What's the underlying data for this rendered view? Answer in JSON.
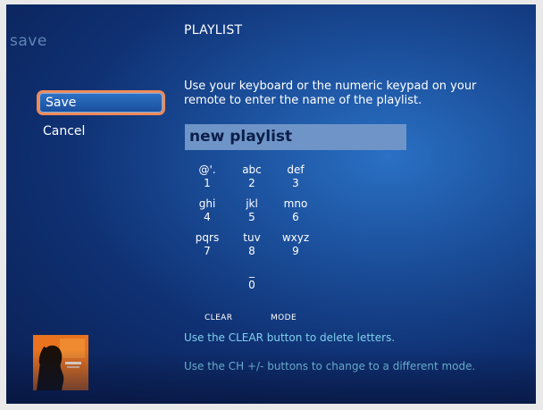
{
  "page_label": "save",
  "menu": {
    "items": [
      {
        "label": "Save",
        "selected": true
      },
      {
        "label": "Cancel",
        "selected": false
      }
    ]
  },
  "title": "PLAYLIST",
  "instructions": "Use your keyboard or the numeric keypad on your remote to enter the name of the playlist.",
  "name_field": {
    "value": "new playlist"
  },
  "keypad": {
    "k1": {
      "letters": "@'.",
      "digit": "1"
    },
    "k2": {
      "letters": "abc",
      "digit": "2"
    },
    "k3": {
      "letters": "def",
      "digit": "3"
    },
    "k4": {
      "letters": "ghi",
      "digit": "4"
    },
    "k5": {
      "letters": "jkl",
      "digit": "5"
    },
    "k6": {
      "letters": "mno",
      "digit": "6"
    },
    "k7": {
      "letters": "pqrs",
      "digit": "7"
    },
    "k8": {
      "letters": "tuv",
      "digit": "8"
    },
    "k9": {
      "letters": "wxyz",
      "digit": "9"
    },
    "k0": {
      "letters": "_",
      "digit": "0"
    }
  },
  "soft_keys": {
    "clear": "CLEAR",
    "mode": "MODE"
  },
  "hints": {
    "clear": "Use the CLEAR button to delete letters.",
    "mode": "Use the CH +/- buttons to change to a different mode."
  },
  "album_art": {
    "icon": "album-cover-icon",
    "background": "#e9731f"
  },
  "colors": {
    "accent": "#f08a59",
    "hint": "#7fd0ee",
    "field": "#6f95c8",
    "background": "#0f3072"
  }
}
